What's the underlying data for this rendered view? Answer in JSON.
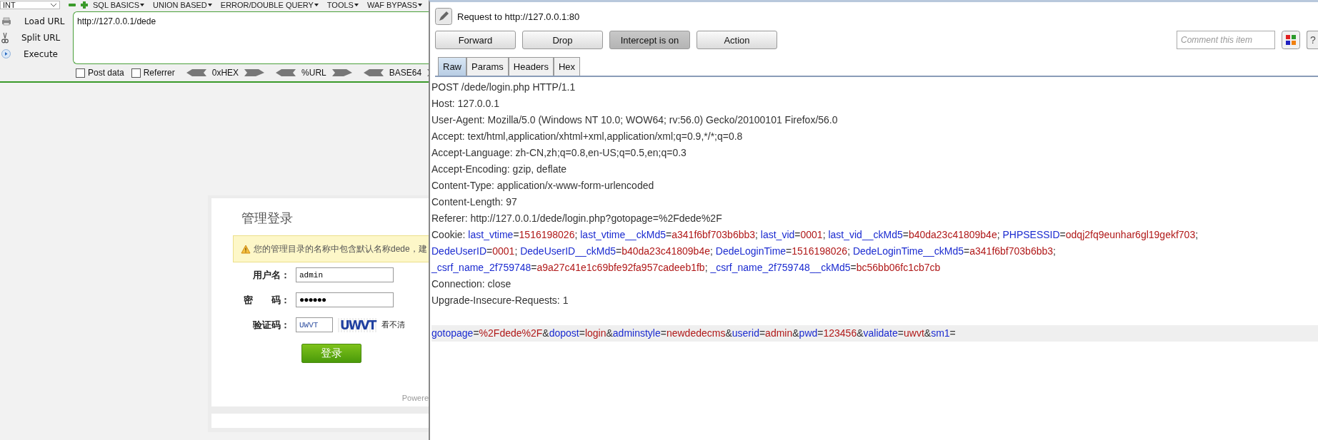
{
  "hackbar": {
    "menu": [
      {
        "label": "INT",
        "kind": "select"
      },
      {
        "label": "SQL BASICS",
        "kind": "menu"
      },
      {
        "label": "UNION BASED",
        "kind": "menu"
      },
      {
        "label": "ERROR/DOUBLE QUERY",
        "kind": "menu"
      },
      {
        "label": "TOOLS",
        "kind": "menu"
      },
      {
        "label": "WAF BYPASS",
        "kind": "menu"
      }
    ],
    "actions": [
      {
        "label": "Load URL",
        "kind": "load"
      },
      {
        "label": "Split URL",
        "kind": "split"
      },
      {
        "label": "Execute",
        "kind": "execute"
      }
    ],
    "url": "http://127.0.0.1/dede",
    "options": [
      {
        "label": "Post data",
        "checked": false
      },
      {
        "label": "Referrer",
        "checked": false
      }
    ],
    "encoders": [
      "0xHEX",
      "%URL",
      "BASE64"
    ]
  },
  "login": {
    "title": "管理登录",
    "warning": "您的管理目录的名称中包含默认名称dede，建",
    "fields": [
      {
        "label": "用户名：",
        "value": "admin",
        "kind": "text"
      },
      {
        "label": "密　　码：",
        "value": "●●●●●●",
        "kind": "password"
      },
      {
        "label": "验证码：",
        "value": "UWVT",
        "kind": "captcha",
        "captcha": "UWVT",
        "hint": "看不清"
      }
    ],
    "button": "登录",
    "footer": "Powere"
  },
  "burp": {
    "title": "Request to http://127.0.0.1:80",
    "buttons": [
      {
        "label": "Forward",
        "selected": false
      },
      {
        "label": "Drop",
        "selected": false
      },
      {
        "label": "Intercept is on",
        "selected": true
      },
      {
        "label": "Action",
        "selected": false
      }
    ],
    "comment": {
      "placeholder": "Comment this item"
    },
    "help": "?",
    "tabs": [
      {
        "label": "Raw",
        "selected": true
      },
      {
        "label": "Params",
        "selected": false
      },
      {
        "label": "Headers",
        "selected": false
      },
      {
        "label": "Hex",
        "selected": false
      }
    ],
    "lines": [
      [
        {
          "kind": "plain",
          "text": "POST /dede/login.php HTTP/1.1"
        }
      ],
      [
        {
          "kind": "plain",
          "text": "Host: 127.0.0.1"
        }
      ],
      [
        {
          "kind": "plain",
          "text": "User-Agent: Mozilla/5.0 (Windows NT 10.0; WOW64; rv:56.0) Gecko/20100101 Firefox/56.0"
        }
      ],
      [
        {
          "kind": "plain",
          "text": "Accept: text/html,application/xhtml+xml,application/xml;q=0.9,*/*;q=0.8"
        }
      ],
      [
        {
          "kind": "plain",
          "text": "Accept-Language: zh-CN,zh;q=0.8,en-US;q=0.5,en;q=0.3"
        }
      ],
      [
        {
          "kind": "plain",
          "text": "Accept-Encoding: gzip, deflate"
        }
      ],
      [
        {
          "kind": "plain",
          "text": "Content-Type: application/x-www-form-urlencoded"
        }
      ],
      [
        {
          "kind": "plain",
          "text": "Content-Length: 97"
        }
      ],
      [
        {
          "kind": "plain",
          "text": "Referer: http://127.0.0.1/dede/login.php?gotopage=%2Fdede%2F"
        }
      ],
      [
        {
          "kind": "plain",
          "text": "Cookie: "
        },
        {
          "kind": "name",
          "text": "last_vtime"
        },
        {
          "kind": "plain",
          "text": "="
        },
        {
          "kind": "value",
          "text": "1516198026"
        },
        {
          "kind": "plain",
          "text": "; "
        },
        {
          "kind": "name",
          "text": "last_vtime__ckMd5"
        },
        {
          "kind": "plain",
          "text": "="
        },
        {
          "kind": "value",
          "text": "a341f6bf703b6bb3"
        },
        {
          "kind": "plain",
          "text": "; "
        },
        {
          "kind": "name",
          "text": "last_vid"
        },
        {
          "kind": "plain",
          "text": "="
        },
        {
          "kind": "value",
          "text": "0001"
        },
        {
          "kind": "plain",
          "text": "; "
        },
        {
          "kind": "name",
          "text": "last_vid__ckMd5"
        },
        {
          "kind": "plain",
          "text": "="
        },
        {
          "kind": "value",
          "text": "b40da23c41809b4e"
        },
        {
          "kind": "plain",
          "text": "; "
        },
        {
          "kind": "name",
          "text": "PHPSESSID"
        },
        {
          "kind": "plain",
          "text": "="
        },
        {
          "kind": "value",
          "text": "odqj2fq9eunhar6gl19gekf703"
        },
        {
          "kind": "plain",
          "text": ";"
        }
      ],
      [
        {
          "kind": "name",
          "text": "DedeUserID"
        },
        {
          "kind": "plain",
          "text": "="
        },
        {
          "kind": "value",
          "text": "0001"
        },
        {
          "kind": "plain",
          "text": "; "
        },
        {
          "kind": "name",
          "text": "DedeUserID__ckMd5"
        },
        {
          "kind": "plain",
          "text": "="
        },
        {
          "kind": "value",
          "text": "b40da23c41809b4e"
        },
        {
          "kind": "plain",
          "text": "; "
        },
        {
          "kind": "name",
          "text": "DedeLoginTime"
        },
        {
          "kind": "plain",
          "text": "="
        },
        {
          "kind": "value",
          "text": "1516198026"
        },
        {
          "kind": "plain",
          "text": "; "
        },
        {
          "kind": "name",
          "text": "DedeLoginTime__ckMd5"
        },
        {
          "kind": "plain",
          "text": "="
        },
        {
          "kind": "value",
          "text": "a341f6bf703b6bb3"
        },
        {
          "kind": "plain",
          "text": ";"
        }
      ],
      [
        {
          "kind": "name",
          "text": "_csrf_name_2f759748"
        },
        {
          "kind": "plain",
          "text": "="
        },
        {
          "kind": "value",
          "text": "a9a27c41e1c69bfe92fa957cadeeb1fb"
        },
        {
          "kind": "plain",
          "text": "; "
        },
        {
          "kind": "name",
          "text": "_csrf_name_2f759748__ckMd5"
        },
        {
          "kind": "plain",
          "text": "="
        },
        {
          "kind": "value",
          "text": "bc56bb06fc1cb7cb"
        }
      ],
      [
        {
          "kind": "plain",
          "text": "Connection: close"
        }
      ],
      [
        {
          "kind": "plain",
          "text": "Upgrade-Insecure-Requests: 1"
        }
      ]
    ],
    "body": [
      {
        "kind": "name",
        "text": "gotopage"
      },
      {
        "kind": "plain",
        "text": "="
      },
      {
        "kind": "value",
        "text": "%2Fdede%2F"
      },
      {
        "kind": "plain",
        "text": "&"
      },
      {
        "kind": "name",
        "text": "dopost"
      },
      {
        "kind": "plain",
        "text": "="
      },
      {
        "kind": "value",
        "text": "login"
      },
      {
        "kind": "plain",
        "text": "&"
      },
      {
        "kind": "name",
        "text": "adminstyle"
      },
      {
        "kind": "plain",
        "text": "="
      },
      {
        "kind": "value",
        "text": "newdedecms"
      },
      {
        "kind": "plain",
        "text": "&"
      },
      {
        "kind": "name",
        "text": "userid"
      },
      {
        "kind": "plain",
        "text": "="
      },
      {
        "kind": "value",
        "text": "admin"
      },
      {
        "kind": "plain",
        "text": "&"
      },
      {
        "kind": "name",
        "text": "pwd"
      },
      {
        "kind": "plain",
        "text": "="
      },
      {
        "kind": "value",
        "text": "123456"
      },
      {
        "kind": "plain",
        "text": "&"
      },
      {
        "kind": "name",
        "text": "validate"
      },
      {
        "kind": "plain",
        "text": "="
      },
      {
        "kind": "value",
        "text": "uwvt"
      },
      {
        "kind": "plain",
        "text": "&"
      },
      {
        "kind": "name",
        "text": "sm1"
      },
      {
        "kind": "plain",
        "text": "="
      }
    ]
  }
}
